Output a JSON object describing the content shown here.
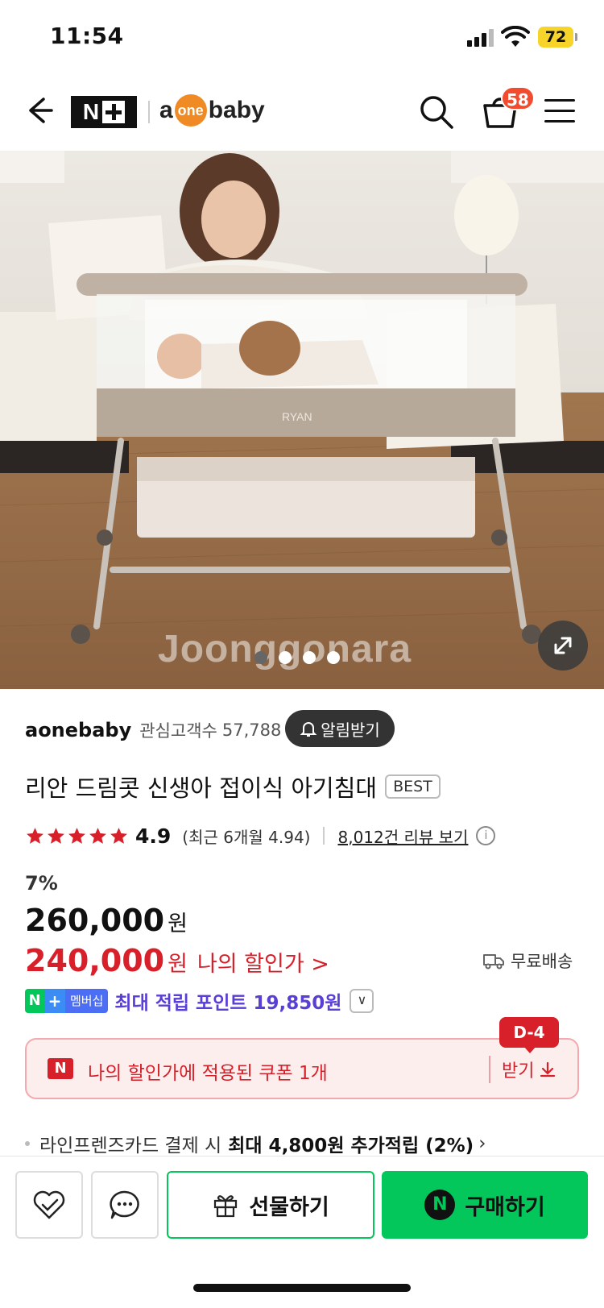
{
  "status_bar": {
    "time": "11:54",
    "battery": "72",
    "icons": [
      "cellular-signal-icon",
      "wifi-icon",
      "battery-icon"
    ]
  },
  "header": {
    "nplus_logo": "N+",
    "brand_logo": {
      "a": "a",
      "one": "one",
      "baby": "baby"
    },
    "cart_count": "58",
    "icons": [
      "back-arrow-icon",
      "search-icon",
      "shopping-bag-icon",
      "hamburger-menu-icon"
    ]
  },
  "gallery": {
    "watermark": "Joonggonara",
    "slide_count": 4,
    "active_slide": 1,
    "image_description": "mother leaning over a bedside baby crib with infant and teddy bear"
  },
  "store": {
    "name": "aonebaby",
    "followers_label": "관심고객수",
    "followers_count": "57,788",
    "notify_label": "알림받기"
  },
  "product": {
    "title": "리안 드림콧 신생아 접이식 아기침대",
    "badge": "BEST",
    "rating": "4.9",
    "rating_stars": 5,
    "recent_rating": "(최근 6개월 4.94)",
    "reviews_link": "8,012건 리뷰 보기",
    "info_mark": "i"
  },
  "price": {
    "discount_rate": "7%",
    "original": "260,000",
    "original_unit": "원",
    "sale": "240,000",
    "sale_unit": "원",
    "my_price_link": "나의 할인가 >",
    "shipping": "무료배송"
  },
  "membership": {
    "badge_n": "N",
    "badge_plus": "+",
    "badge_text": "멤버십",
    "points_text": "최대 적립 포인트 19,850원",
    "toggle": "∨"
  },
  "coupon": {
    "n_mark": "N",
    "text": "나의 할인가에 적용된 쿠폰 1개",
    "receive": "받기",
    "dday": "D-4"
  },
  "card_benefit": {
    "prefix": "라인프렌즈카드 결제 시",
    "bold": "최대 4,800원 추가적립 (2%)",
    "chevron": "›"
  },
  "bottom_bar": {
    "gift_label": "선물하기",
    "buy_label": "구매하기",
    "buy_n": "N"
  },
  "colors": {
    "naver_green": "#03c75a",
    "sale_red": "#d7202a",
    "points_purple": "#5a3fd6",
    "cart_badge": "#f24b2d",
    "battery_yellow": "#f7d42a"
  }
}
